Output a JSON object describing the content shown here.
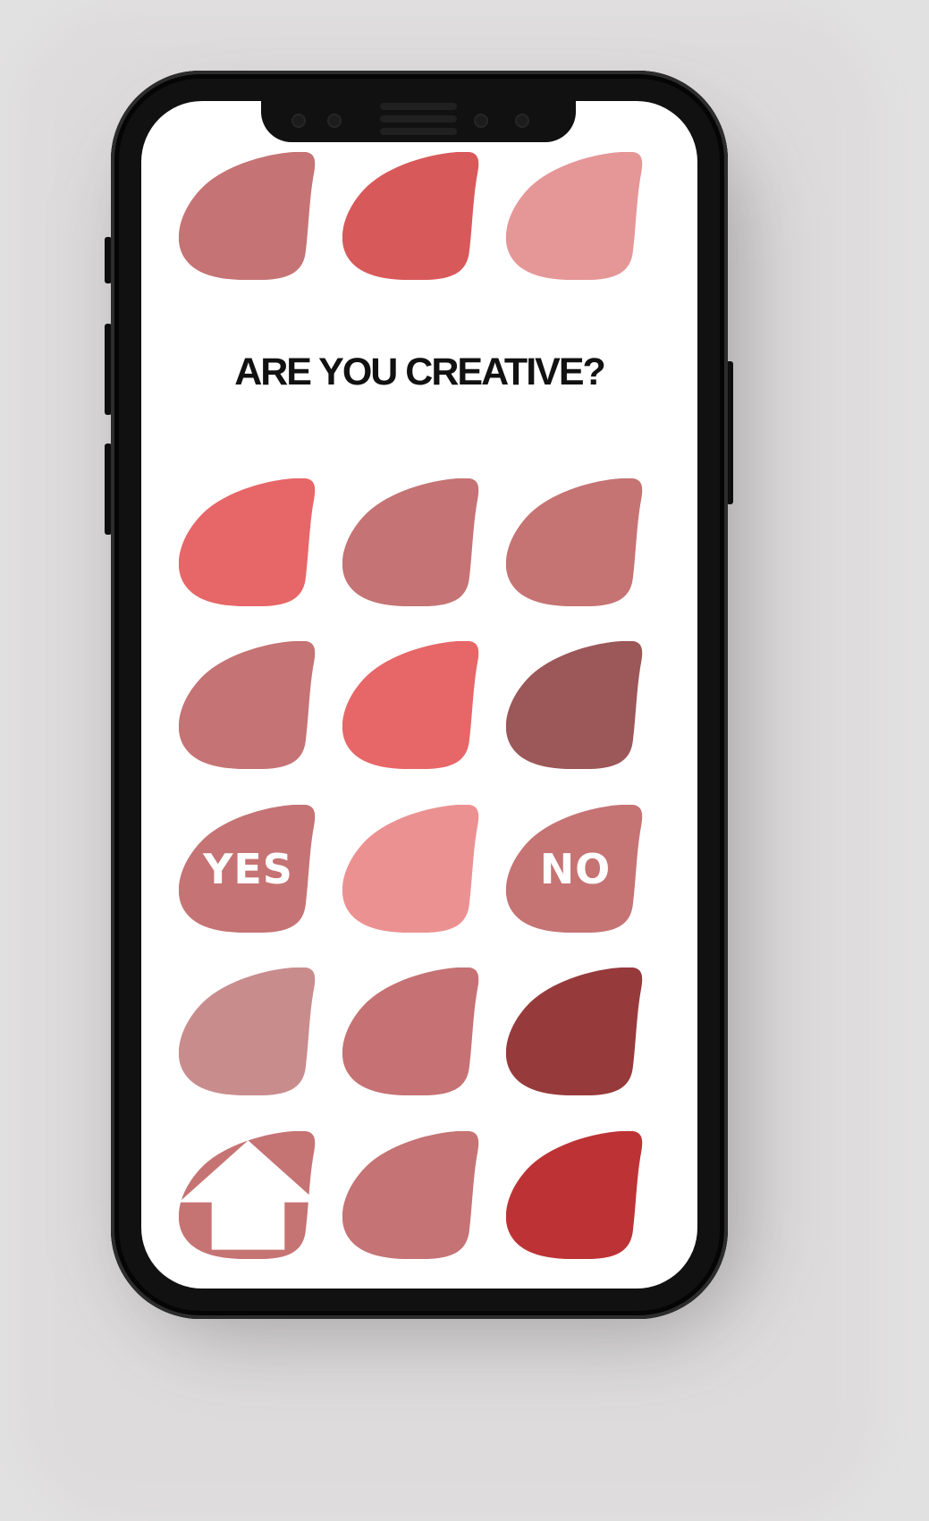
{
  "screen": {
    "question": "ARE YOU CREATIVE?"
  },
  "blobs_top": [
    {
      "color": "#c57374"
    },
    {
      "color": "#d8595a"
    },
    {
      "color": "#e59697"
    }
  ],
  "grid": [
    [
      {
        "color": "#e76667"
      },
      {
        "color": "#c57374"
      },
      {
        "color": "#c67374"
      }
    ],
    [
      {
        "color": "#c57374"
      },
      {
        "color": "#e76667"
      },
      {
        "color": "#9c5758"
      }
    ],
    [
      {
        "color": "#c57374",
        "label": "YES"
      },
      {
        "color": "#ec9192"
      },
      {
        "color": "#c67374",
        "label": "NO"
      }
    ],
    [
      {
        "color": "#c98c8d"
      },
      {
        "color": "#c67173"
      },
      {
        "color": "#973a3b"
      }
    ],
    [
      {
        "color": "#c67374",
        "icon": "home-arrow-icon"
      },
      {
        "color": "#c57374"
      },
      {
        "color": "#bd3335"
      }
    ]
  ],
  "buttons": {
    "yes_label": "YES",
    "no_label": "NO"
  }
}
